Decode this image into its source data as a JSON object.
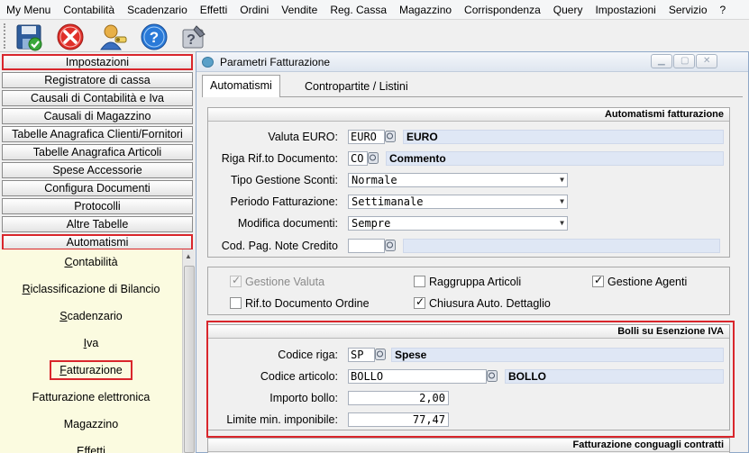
{
  "menubar": [
    "My Menu",
    "Contabilità",
    "Scadenzario",
    "Effetti",
    "Ordini",
    "Vendite",
    "Reg. Cassa",
    "Magazzino",
    "Corrispondenza",
    "Query",
    "Impostazioni",
    "Servizio",
    "?"
  ],
  "toolbar": {
    "icons": [
      "save-icon",
      "close-icon",
      "user-key-icon",
      "help-icon",
      "edit-help-icon"
    ]
  },
  "left_nav": {
    "buttons": [
      "Impostazioni",
      "Registratore di cassa",
      "Causali di Contabilità e Iva",
      "Causali di Magazzino",
      "Tabelle Anagrafica Clienti/Fornitori",
      "Tabelle Anagrafica Articoli",
      "Spese Accessorie",
      "Configura Documenti",
      "Protocolli",
      "Altre Tabelle",
      "Automatismi"
    ],
    "subitems": [
      "Contabilità",
      "Riclassificazione di Bilancio",
      "Scadenzario",
      "Iva",
      "Fatturazione",
      "Fatturazione elettronica",
      "Magazzino",
      "Effetti"
    ],
    "subitem_underline": [
      "C",
      "R",
      "S",
      "I",
      "F",
      "",
      "",
      "E"
    ],
    "subitem_rest": [
      "ontabilità",
      "iclassificazione di Bilancio",
      "cadenzario",
      "va",
      "atturazione",
      "Fatturazione elettronica",
      "Magazzino",
      "ffetti"
    ]
  },
  "window": {
    "title": "Parametri Fatturazione",
    "tabs": [
      "Automatismi",
      "Contropartite / Listini"
    ]
  },
  "automatismi": {
    "header": "Automatismi fatturazione",
    "valuta_label": "Valuta EURO:",
    "valuta_code": "EURO",
    "valuta_desc": "EURO",
    "riga_label": "Riga Rif.to Documento:",
    "riga_code": "CO",
    "riga_desc": "Commento",
    "sconti_label": "Tipo Gestione Sconti:",
    "sconti_value": "Normale",
    "periodo_label": "Periodo Fatturazione:",
    "periodo_value": "Settimanale",
    "modifica_label": "Modifica documenti:",
    "modifica_value": "Sempre",
    "codpag_label": "Cod. Pag. Note Credito",
    "codpag_code": "",
    "codpag_desc": ""
  },
  "options": {
    "gestione_valuta": "Gestione Valuta",
    "raggruppa": "Raggruppa Articoli",
    "gestione_agenti": "Gestione Agenti",
    "rif_ordine": "Rif.to Documento Ordine",
    "chiusura": "Chiusura Auto. Dettaglio",
    "checked": {
      "gestione_valuta": true,
      "raggruppa": false,
      "gestione_agenti": true,
      "rif_ordine": false,
      "chiusura": true
    }
  },
  "bolli": {
    "header": "Bolli su Esenzione IVA",
    "codice_riga_label": "Codice riga:",
    "codice_riga_code": "SP",
    "codice_riga_desc": "Spese",
    "codice_art_label": "Codice articolo:",
    "codice_art_code": "BOLLO",
    "codice_art_desc": "BOLLO",
    "importo_label": "Importo bollo:",
    "importo_value": "2,00",
    "limite_label": "Limite min. imponibile:",
    "limite_value": "77,47"
  },
  "conguagli": {
    "header": "Fatturazione conguagli contratti"
  },
  "colors": {
    "highlight_frame": "#d9262c",
    "desc_field": "#dfe7f5",
    "sublist_bg": "#fbfbe0"
  }
}
